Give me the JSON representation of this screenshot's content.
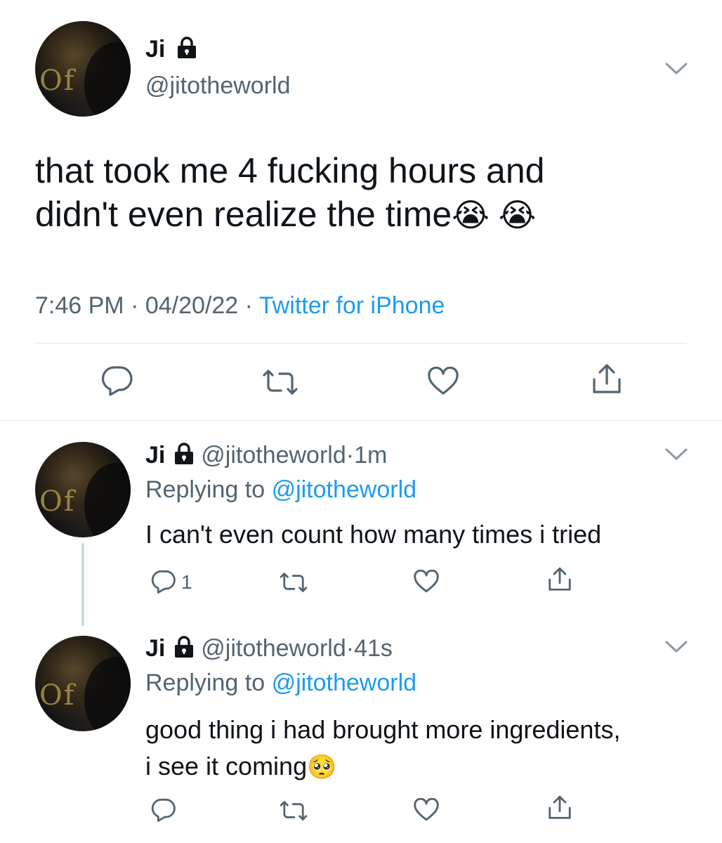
{
  "main_tweet": {
    "author_name": "Ji",
    "author_handle": "@jitotheworld",
    "text_line1": "that took me 4 fucking hours and",
    "text_line2": "didn't even realize the time",
    "text_emoji": "😭 😭",
    "time": "7:46 PM",
    "date": "04/20/22",
    "source": "Twitter for iPhone",
    "separator": "·"
  },
  "replies": [
    {
      "author_name": "Ji",
      "author_handle": "@jitotheworld",
      "age": "1m",
      "replying_prefix": "Replying to",
      "replying_to": "@jitotheworld",
      "text_line1": "I can't even count how many times i tried",
      "reply_count": "1"
    },
    {
      "author_name": "Ji",
      "author_handle": "@jitotheworld",
      "age": "41s",
      "replying_prefix": "Replying to",
      "replying_to": "@jitotheworld",
      "text_line1": "good thing i had brought more ingredients,",
      "text_line2": "i see it coming",
      "text_emoji": "🥺"
    }
  ],
  "avatar_text": "Of",
  "icons": [
    "lock-icon",
    "chevron-down-icon",
    "reply-icon",
    "retweet-icon",
    "like-icon",
    "share-icon"
  ],
  "colors": {
    "text": "#0f1419",
    "secondary": "#536471",
    "link": "#1d9bf0",
    "divider": "#e1e5e8"
  }
}
